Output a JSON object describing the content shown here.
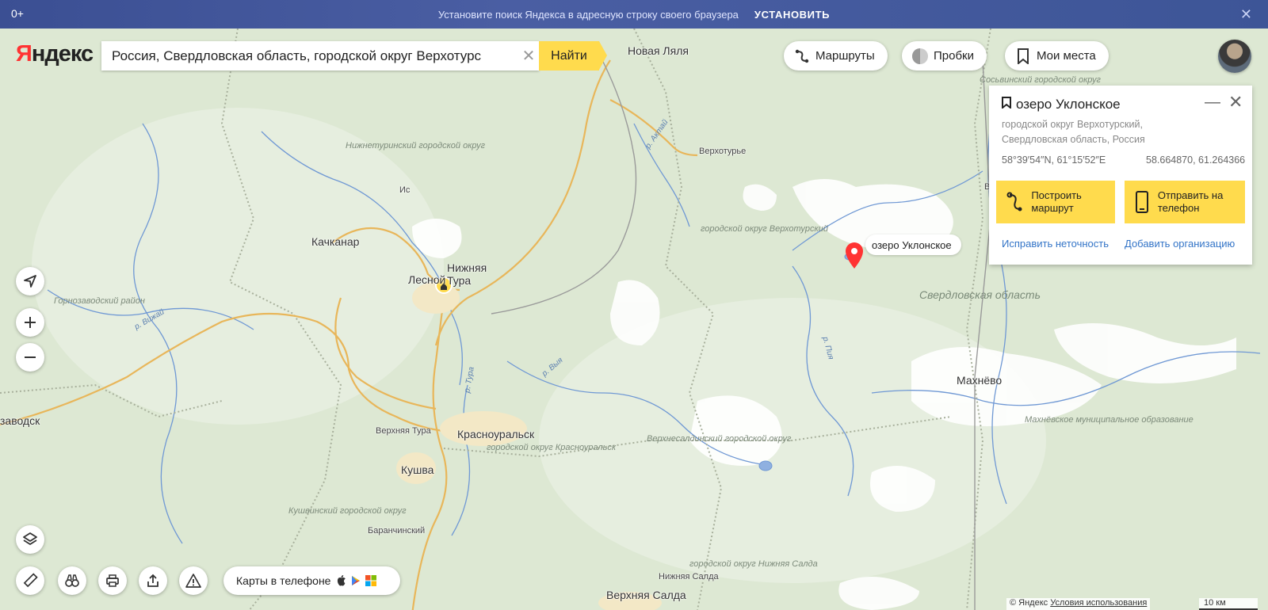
{
  "promo": {
    "age": "0+",
    "text": "Установите поиск Яндекса в адресную строку своего браузера",
    "install": "УСТАНОВИТЬ",
    "close": "✕"
  },
  "logo": {
    "first": "Я",
    "rest": "ндекс"
  },
  "search": {
    "value": "Россия, Свердловская область, городской округ Верхотурс",
    "clear": "✕",
    "button": "Найти"
  },
  "toolbar": {
    "routes": "Маршруты",
    "traffic": "Пробки",
    "places": "Мои места"
  },
  "card": {
    "title": "озеро Уклонское",
    "address": "городской округ Верхотурский, Свердловская область, Россия",
    "coords_dms": "58°39′54″N, 61°15′52″E",
    "coords_dec": "58.664870, 61.264366",
    "route_btn": "Построить маршрут",
    "phone_btn": "Отправить на телефон",
    "fix_link": "Исправить неточность",
    "add_link": "Добавить организацию"
  },
  "pin": {
    "label": "озеро Уклонское"
  },
  "phone_pill": {
    "label": "Карты в телефоне"
  },
  "places": {
    "novaya_lyalya": "Новая Ляля",
    "verkhoturye": "Верхотурье",
    "is": "Ис",
    "kachkanar": "Качканар",
    "nizhnyaya_tura": "Нижняя\nТура",
    "lesnoy": "Лесной",
    "zavodsk": "заводск",
    "verkhnyaya_tura": "Верхняя Тура",
    "krasnouralsk": "Красноуральск",
    "kushva": "Кушва",
    "baranchinsky": "Баранчинский",
    "makhnevo": "Махнёво",
    "nizhnyaya_salda": "Нижняя Салда",
    "verkhnyaya_salda": "Верхняя Салда",
    "v": "В"
  },
  "regions": {
    "sosva": "Сосьвинский городской округ",
    "nizhneturinsky": "Нижнетуринский городской округ",
    "verkhotursky": "городской округ Верхотурский",
    "sverdlovsk": "Свердловская область",
    "gornozavodsky": "Горнозаводский район",
    "krasnouralsk": "городской округ Красноуральск",
    "verkhnesaldinsky": "Верхнесалдинский городской округ",
    "makhnevo_mo": "Махнёвское муниципальное образование",
    "kushvinsky": "Кушвинский городской округ",
    "nizhnyaya_salda": "городской округ Нижняя Салда"
  },
  "rivers": {
    "aktay": "р. Актай",
    "vizhay": "р. Вижай",
    "vyya": "р. Выя",
    "tura": "р. Тура",
    "piya": "р. Пия"
  },
  "footer": {
    "copyright": "© Яндекс",
    "terms": "Условия использования",
    "scale": "10 км"
  },
  "colors": {
    "accent": "#ffdb4d",
    "link": "#3374c7",
    "pin": "#f33",
    "road": "#e8b65a",
    "water": "#6f98d4",
    "promo": "#3b4f93"
  }
}
